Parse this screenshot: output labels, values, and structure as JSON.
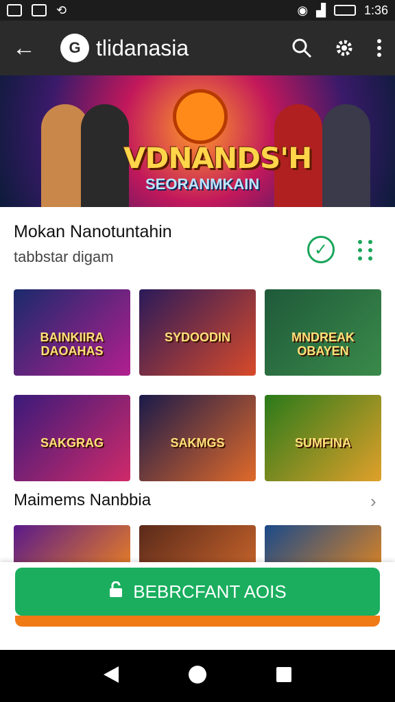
{
  "status_bar": {
    "time": "1:36"
  },
  "app_bar": {
    "title": "tlidanasia",
    "logo_glyph": "G"
  },
  "banner": {
    "title": "VDNANDS'H",
    "subtitle": "SEORANMKAIN"
  },
  "section": {
    "title": "Mokan Nanotuntahin",
    "subtitle": "tabbstar digam"
  },
  "grid_row_1": [
    {
      "label": "BAINKIIRA\nDAOAHAS",
      "colors": [
        "#1a2a6c",
        "#b21f8f"
      ]
    },
    {
      "label": "SYDOODIN",
      "colors": [
        "#2a1a5a",
        "#d84a2a"
      ]
    },
    {
      "label": "MNDREAK\nOBAYEN",
      "colors": [
        "#1f5a3a",
        "#3a8a4a"
      ]
    }
  ],
  "grid_row_2": [
    {
      "label": "SAKGRAG",
      "colors": [
        "#3a1a7a",
        "#d02a6a"
      ]
    },
    {
      "label": "SAKMGS",
      "colors": [
        "#1a1a4a",
        "#e06a2a"
      ]
    },
    {
      "label": "SUMFINA",
      "colors": [
        "#2a7a1a",
        "#e0a02a"
      ]
    }
  ],
  "row_title": "Maimems Nanbbia",
  "grid_row_3": [
    {
      "colors": [
        "#5a1a8a",
        "#e07a2a"
      ]
    },
    {
      "colors": [
        "#5a2a1a",
        "#c0602a"
      ]
    },
    {
      "colors": [
        "#1a4a8a",
        "#d0802a"
      ]
    }
  ],
  "cta": {
    "label": "BEBRCFANT AOIS"
  },
  "accent_colors": {
    "green": "#1aae5e",
    "orange": "#f07a16",
    "app_bar": "#2b2b2b"
  }
}
